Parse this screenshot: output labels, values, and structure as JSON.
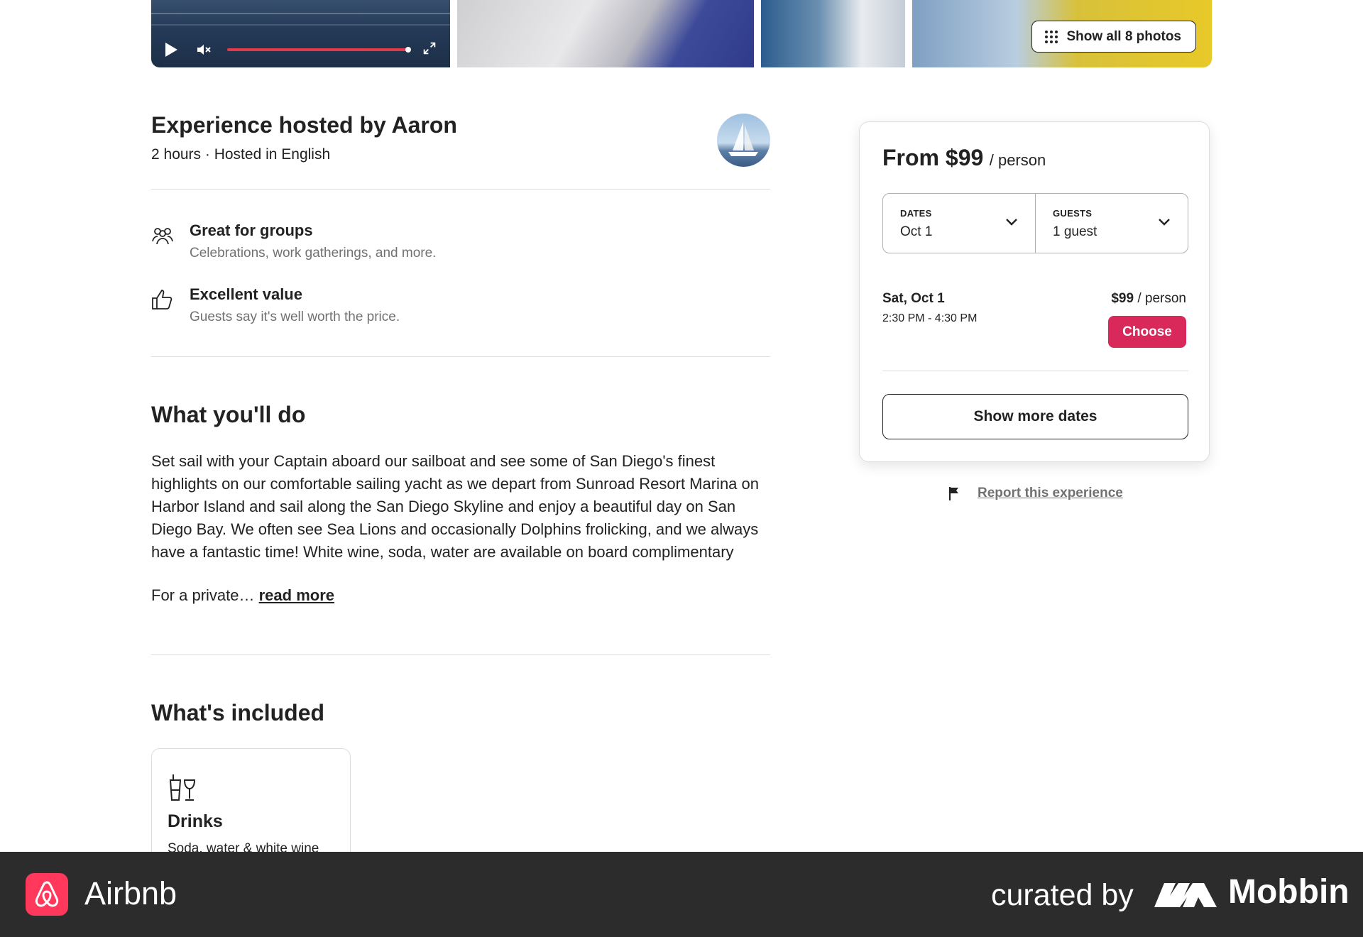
{
  "gallery": {
    "show_photos_label": "Show all 8 photos",
    "video": {
      "progress": 0.97
    }
  },
  "host": {
    "title": "Experience hosted by Aaron",
    "subtitle": "2 hours · Hosted in English"
  },
  "features": [
    {
      "icon": "group-icon",
      "title": "Great for groups",
      "desc": "Celebrations, work gatherings, and more."
    },
    {
      "icon": "thumbs-up-icon",
      "title": "Excellent value",
      "desc": "Guests say it's well worth the price."
    }
  ],
  "what_you_do": {
    "title": "What you'll do",
    "body": "Set sail with your Captain aboard our sailboat and see some of San Diego's finest highlights on our comfortable sailing yacht as we depart from Sunroad Resort Marina on Harbor Island and sail along the San Diego Skyline and enjoy a beautiful day on San Diego Bay. We often see Sea Lions and occasionally Dolphins frolicking, and we always have a fantastic time! White wine, soda, water are available on board complimentary",
    "more_prefix": "For a private…",
    "read_more": "read more"
  },
  "included": {
    "title": "What's included",
    "items": [
      {
        "icon": "drinks-icon",
        "title": "Drinks",
        "desc": "Soda, water & white wine"
      }
    ]
  },
  "booking": {
    "price_prefix": "From $99",
    "price_unit": "/ person",
    "dates_label": "DATES",
    "dates_value": "Oct 1",
    "guests_label": "GUESTS",
    "guests_value": "1 guest",
    "slot": {
      "date": "Sat, Oct 1",
      "time": "2:30 PM - 4:30 PM",
      "price": "$99",
      "price_unit": "/ person",
      "choose_label": "Choose"
    },
    "more_dates_label": "Show more dates"
  },
  "report_label": "Report this experience",
  "footer": {
    "brand": "Airbnb",
    "curated_by": "curated by",
    "curator": "Mobbin"
  },
  "colors": {
    "accent": "#d9285a",
    "footer_bg": "#2c2c2d",
    "airbnb_brand": "#ff385c",
    "progress": "#e13a4a"
  }
}
